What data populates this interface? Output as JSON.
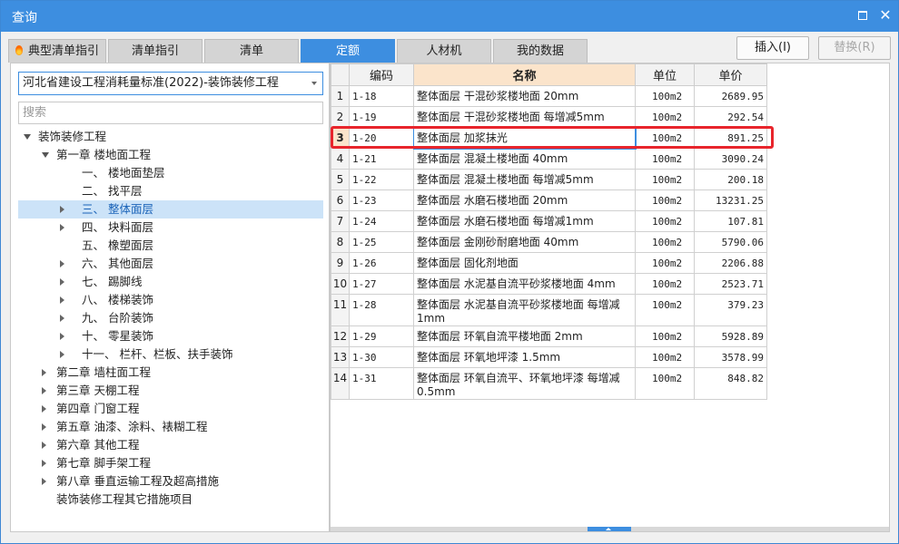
{
  "window": {
    "title": "查询"
  },
  "tabs": [
    {
      "label": "典型清单指引",
      "has_icon": true
    },
    {
      "label": "清单指引"
    },
    {
      "label": "清单"
    },
    {
      "label": "定额",
      "active": true
    },
    {
      "label": "人材机"
    },
    {
      "label": "我的数据"
    }
  ],
  "actions": {
    "insert": "插入(I)",
    "replace": "替换(R)"
  },
  "left": {
    "library": "河北省建设工程消耗量标准(2022)-装饰装修工程",
    "search_placeholder": "搜索",
    "tree": [
      {
        "label": "装饰装修工程",
        "level": 0,
        "toggle": "open"
      },
      {
        "label": "第一章 楼地面工程",
        "level": 1,
        "toggle": "open"
      },
      {
        "label": "一、 楼地面垫层",
        "level": 2,
        "toggle": "none"
      },
      {
        "label": "二、 找平层",
        "level": 2,
        "toggle": "none"
      },
      {
        "label": "三、 整体面层",
        "level": 2,
        "toggle": "closed",
        "selected": true
      },
      {
        "label": "四、 块料面层",
        "level": 2,
        "toggle": "closed"
      },
      {
        "label": "五、 橡塑面层",
        "level": 2,
        "toggle": "none"
      },
      {
        "label": "六、 其他面层",
        "level": 2,
        "toggle": "closed"
      },
      {
        "label": "七、 踢脚线",
        "level": 2,
        "toggle": "closed"
      },
      {
        "label": "八、 楼梯装饰",
        "level": 2,
        "toggle": "closed"
      },
      {
        "label": "九、 台阶装饰",
        "level": 2,
        "toggle": "closed"
      },
      {
        "label": "十、 零星装饰",
        "level": 2,
        "toggle": "closed"
      },
      {
        "label": "十一、 栏杆、栏板、扶手装饰",
        "level": 2,
        "toggle": "closed"
      },
      {
        "label": "第二章 墙柱面工程",
        "level": 1,
        "toggle": "closed"
      },
      {
        "label": "第三章 天棚工程",
        "level": 1,
        "toggle": "closed"
      },
      {
        "label": "第四章 门窗工程",
        "level": 1,
        "toggle": "closed"
      },
      {
        "label": "第五章 油漆、涂料、裱糊工程",
        "level": 1,
        "toggle": "closed"
      },
      {
        "label": "第六章 其他工程",
        "level": 1,
        "toggle": "closed"
      },
      {
        "label": "第七章 脚手架工程",
        "level": 1,
        "toggle": "closed"
      },
      {
        "label": "第八章 垂直运输工程及超高措施",
        "level": 1,
        "toggle": "closed"
      },
      {
        "label": "装饰装修工程其它措施项目",
        "level": 1,
        "toggle": "none"
      }
    ]
  },
  "table": {
    "headers": {
      "code": "编码",
      "name": "名称",
      "unit": "单位",
      "price": "单价"
    },
    "rows": [
      {
        "no": "1",
        "code": "1-18",
        "name": "整体面层 干混砂浆楼地面 20mm",
        "unit": "100m2",
        "price": "2689.95"
      },
      {
        "no": "2",
        "code": "1-19",
        "name": "整体面层 干混砂浆楼地面 每增减5mm",
        "unit": "100m2",
        "price": "292.54"
      },
      {
        "no": "3",
        "code": "1-20",
        "name": "整体面层 加浆抹光",
        "unit": "100m2",
        "price": "891.25",
        "active": true
      },
      {
        "no": "4",
        "code": "1-21",
        "name": "整体面层 混凝土楼地面 40mm",
        "unit": "100m2",
        "price": "3090.24"
      },
      {
        "no": "5",
        "code": "1-22",
        "name": "整体面层 混凝土楼地面 每增减5mm",
        "unit": "100m2",
        "price": "200.18"
      },
      {
        "no": "6",
        "code": "1-23",
        "name": "整体面层 水磨石楼地面 20mm",
        "unit": "100m2",
        "price": "13231.25"
      },
      {
        "no": "7",
        "code": "1-24",
        "name": "整体面层 水磨石楼地面 每增减1mm",
        "unit": "100m2",
        "price": "107.81"
      },
      {
        "no": "8",
        "code": "1-25",
        "name": "整体面层 金刚砂耐磨地面 40mm",
        "unit": "100m2",
        "price": "5790.06"
      },
      {
        "no": "9",
        "code": "1-26",
        "name": "整体面层 固化剂地面",
        "unit": "100m2",
        "price": "2206.88"
      },
      {
        "no": "10",
        "code": "1-27",
        "name": "整体面层 水泥基自流平砂浆楼地面 4mm",
        "unit": "100m2",
        "price": "2523.71"
      },
      {
        "no": "11",
        "code": "1-28",
        "name": "整体面层 水泥基自流平砂浆楼地面 每增减1mm",
        "unit": "100m2",
        "price": "379.23",
        "tall": true
      },
      {
        "no": "12",
        "code": "1-29",
        "name": "整体面层 环氧自流平楼地面 2mm",
        "unit": "100m2",
        "price": "5928.89"
      },
      {
        "no": "13",
        "code": "1-30",
        "name": "整体面层 环氧地坪漆 1.5mm",
        "unit": "100m2",
        "price": "3578.99"
      },
      {
        "no": "14",
        "code": "1-31",
        "name": "整体面层 环氧自流平、环氧地坪漆 每增减0.5mm",
        "unit": "100m2",
        "price": "848.82",
        "tall": true
      }
    ]
  },
  "colors": {
    "accent": "#3d8ee0",
    "highlight_border": "#e8252c",
    "header_highlight": "#fbe4cb",
    "selection": "#cce3f8"
  }
}
